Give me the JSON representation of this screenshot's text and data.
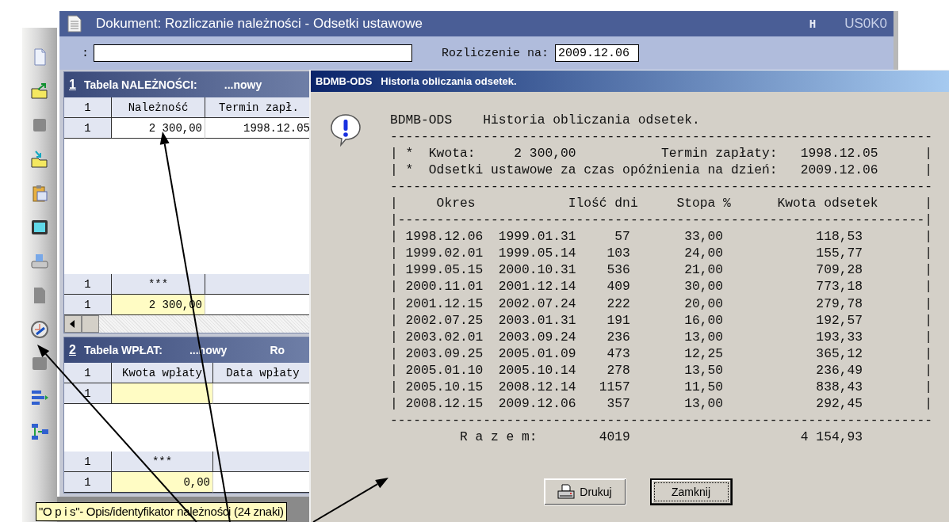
{
  "window": {
    "title": "Dokument: Rozliczanie należności - Odsetki ustawowe",
    "flag": "H",
    "code": "US0K0"
  },
  "form": {
    "description_label": ":",
    "date_label": "Rozliczenie na:",
    "date_value": "2009.12.06"
  },
  "tables": [
    {
      "number": "1",
      "title": "Tabela NALEŻNOŚCI:",
      "status": "...nowy",
      "h_scrollbar": true,
      "columns": [
        "1",
        "Należność",
        "Termin zapł."
      ],
      "rows": [
        {
          "cells": [
            "1",
            "2 300,00",
            "1998.12.05"
          ],
          "highlighted": false
        }
      ],
      "summary_columns": [
        "1",
        "***"
      ],
      "summary_rows": [
        {
          "cells": [
            "1",
            "2 300,00"
          ],
          "highlighted": true
        }
      ]
    },
    {
      "number": "2",
      "title": "Tabela WPŁAT:",
      "status": "...nowy",
      "extra": "Ro",
      "columns": [
        "1",
        "Kwota wpłaty",
        "Data wpłaty"
      ],
      "rows": [
        {
          "cells": [
            "1"
          ],
          "highlighted": true
        }
      ],
      "summary_columns": [
        "1",
        "***"
      ],
      "summary_rows": [
        {
          "cells": [
            "1",
            "0,00"
          ],
          "highlighted": true
        }
      ]
    }
  ],
  "tooltip": "\"O p i s\"- Opis/identyfikator należności (24 znaki)",
  "dialog": {
    "title": "BDMB-ODS   Historia obliczania odsetek.",
    "report_lines": [
      "BDMB-ODS    Historia obliczania odsetek.",
      "----------------------------------------------------------------------",
      "| *  Kwota:     2 300,00           Termin zapłaty:   1998.12.05      |",
      "| *  Odsetki ustawowe za czas opóźnienia na dzień:   2009.12.06      |",
      "----------------------------------------------------------------------",
      "|     Okres            Ilość dni     Stopa %      Kwota odsetek      |",
      "|--------------------------------------------------------------------|",
      "| 1998.12.06  1999.01.31     57       33,00            118,53        |",
      "| 1999.02.01  1999.05.14    103       24,00            155,77        |",
      "| 1999.05.15  2000.10.31    536       21,00            709,28        |",
      "| 2000.11.01  2001.12.14    409       30,00            773,18        |",
      "| 2001.12.15  2002.07.24    222       20,00            279,78        |",
      "| 2002.07.25  2003.01.31    191       16,00            192,57        |",
      "| 2003.02.01  2003.09.24    236       13,00            193,33        |",
      "| 2003.09.25  2005.01.09    473       12,25            365,12        |",
      "| 2005.01.10  2005.10.14    278       13,50            236,49        |",
      "| 2005.10.15  2008.12.14   1157       11,50            838,43        |",
      "| 2008.12.15  2009.12.06    357       13,00            292,45        |",
      "----------------------------------------------------------------------",
      "         R a z e m:        4019                      4 154,93"
    ],
    "buttons": [
      {
        "label": "Drukuj",
        "kind": "print",
        "default": false
      },
      {
        "label": "Zamknij",
        "kind": "plain",
        "default": true
      }
    ]
  }
}
